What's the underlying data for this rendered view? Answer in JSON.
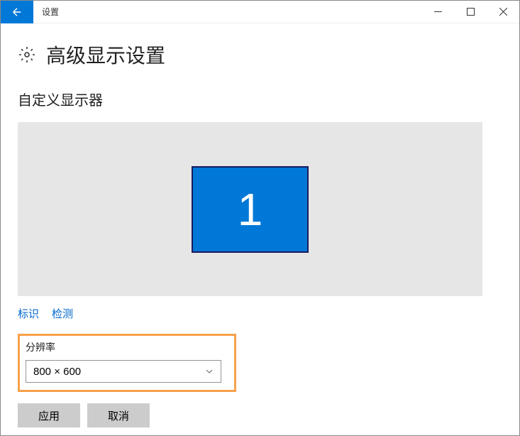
{
  "window": {
    "title": "设置"
  },
  "page": {
    "title": "高级显示设置",
    "section_title": "自定义显示器"
  },
  "display": {
    "monitor_number": "1"
  },
  "links": {
    "identify": "标识",
    "detect": "检测"
  },
  "resolution": {
    "label": "分辨率",
    "value": "800 × 600"
  },
  "buttons": {
    "apply": "应用",
    "cancel": "取消"
  }
}
